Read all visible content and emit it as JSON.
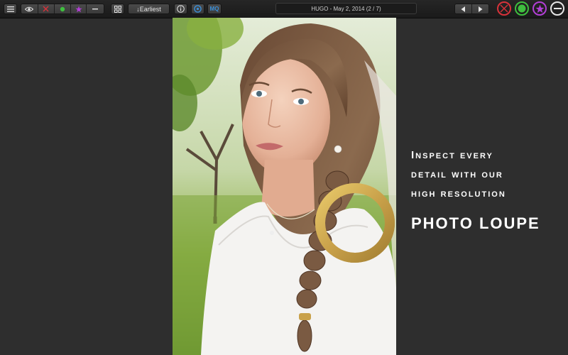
{
  "toolbar": {
    "sort_label": "↓Earliest",
    "mq_label": "MQ",
    "title": "HUGO - May 2, 2014 (2 / 7)"
  },
  "caption": {
    "line1": "Inspect every",
    "line2": "detail with our",
    "line3": "high resolution",
    "line4": "PHOTO LOUPE"
  },
  "icons": {
    "menu": "menu-icon",
    "eye": "eye-icon",
    "reject": "x-icon",
    "accept": "green-dot-icon",
    "star": "star-icon",
    "minus": "minus-icon",
    "grid": "grid-icon",
    "info": "info-icon",
    "zoom": "zoom-icon",
    "prev": "arrow-left-icon",
    "next": "arrow-right-icon"
  },
  "colors": {
    "reject": "#d8323a",
    "accept": "#3fbf3f",
    "star": "#b23fd6",
    "accent_blue": "#3a8fd8",
    "loupe": "#c9a14a"
  }
}
